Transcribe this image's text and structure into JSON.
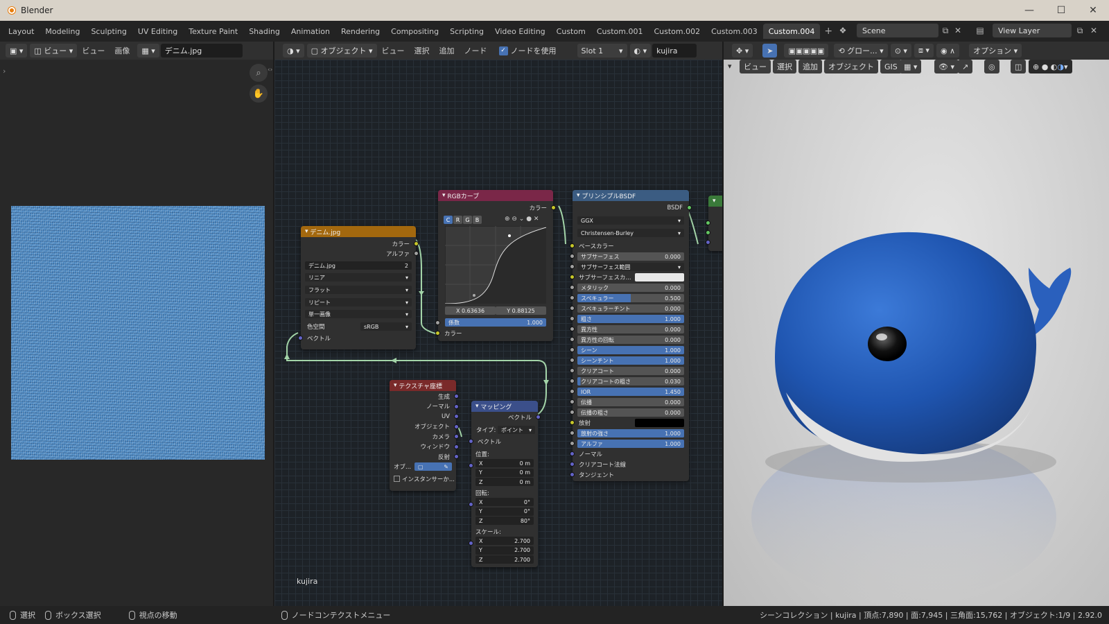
{
  "window": {
    "title": "Blender"
  },
  "workspaces": [
    "Layout",
    "Modeling",
    "Sculpting",
    "UV Editing",
    "Texture Paint",
    "Shading",
    "Animation",
    "Rendering",
    "Compositing",
    "Scripting",
    "Video Editing",
    "Custom",
    "Custom.001",
    "Custom.002",
    "Custom.003",
    "Custom.004"
  ],
  "active_workspace": "Custom.004",
  "scene": "Scene",
  "view_layer": "View Layer",
  "image_editor": {
    "view_menu": "ビュー",
    "image_menu": "画像",
    "view_mode": "ビュー",
    "image_name": "デニム.jpg"
  },
  "node_header": {
    "mode": "オブジェクト",
    "menus": [
      "ビュー",
      "選択",
      "追加",
      "ノード"
    ],
    "use_nodes": "ノードを使用",
    "slot": "Slot 1",
    "material": "kujira"
  },
  "viewport_header": {
    "transform": "グロー...",
    "options": "オプション",
    "menus": [
      "ビュー",
      "選択",
      "追加",
      "オブジェクト",
      "GIS"
    ]
  },
  "object_label": "kujira",
  "nodes": {
    "image": {
      "title": "デニム.jpg",
      "outputs": [
        "カラー",
        "アルファ"
      ],
      "image": "デニム.jpg",
      "users": "2",
      "interp": "リニア",
      "proj": "フラット",
      "ext": "リピート",
      "source": "単一画像",
      "cs_label": "色空間",
      "cs": "sRGB",
      "vector": "ベクトル"
    },
    "rgb": {
      "title": "RGBカーブ",
      "output": "カラー",
      "channels": [
        "C",
        "R",
        "G",
        "B"
      ],
      "x": "X 0.63636",
      "y": "Y 0.88125",
      "fac_label": "係数",
      "fac": "1.000",
      "input": "カラー"
    },
    "bsdf": {
      "title": "プリンシプルBSDF",
      "output": "BSDF",
      "dist": "GGX",
      "ss_method": "Christensen-Burley",
      "rows": [
        {
          "l": "ベースカラー"
        },
        {
          "l": "サブサーフェス",
          "v": "0.000"
        },
        {
          "l": "サブサーフェス範囲",
          "drop": true
        },
        {
          "l": "サブサーフェスカ...",
          "color": "#e8e8e8"
        },
        {
          "l": "メタリック",
          "v": "0.000"
        },
        {
          "l": "スペキュラー",
          "v": "0.500",
          "fill": 0.5
        },
        {
          "l": "スペキュラーチント",
          "v": "0.000"
        },
        {
          "l": "粗さ",
          "v": "1.000",
          "fill": 1
        },
        {
          "l": "異方性",
          "v": "0.000"
        },
        {
          "l": "異方性の回転",
          "v": "0.000"
        },
        {
          "l": "シーン",
          "v": "1.000",
          "fill": 1
        },
        {
          "l": "シーンチント",
          "v": "1.000",
          "fill": 1
        },
        {
          "l": "クリアコート",
          "v": "0.000"
        },
        {
          "l": "クリアコートの粗さ",
          "v": "0.030",
          "fill": 0.03
        },
        {
          "l": "IOR",
          "v": "1.450",
          "fill": 1
        },
        {
          "l": "伝播",
          "v": "0.000"
        },
        {
          "l": "伝播の粗さ",
          "v": "0.000"
        },
        {
          "l": "放射",
          "color": "#000000"
        },
        {
          "l": "放射の強さ",
          "v": "1.000",
          "fill": 1
        },
        {
          "l": "アルファ",
          "v": "1.000",
          "fill": 1
        },
        {
          "l": "ノーマル"
        },
        {
          "l": "クリアコート法線"
        },
        {
          "l": "タンジェント"
        }
      ]
    },
    "texcoord": {
      "title": "テクスチャ座標",
      "outputs": [
        "生成",
        "ノーマル",
        "UV",
        "オブジェクト",
        "カメラ",
        "ウィンドウ",
        "反射"
      ],
      "obj_label": "オブ...",
      "instancer": "インスタンサーか..."
    },
    "mapping": {
      "title": "マッピング",
      "output": "ベクトル",
      "type_label": "タイプ:",
      "type": "ポイント",
      "vector": "ベクトル",
      "loc_label": "位置:",
      "loc": [
        "0 m",
        "0 m",
        "0 m"
      ],
      "rot_label": "回転:",
      "rot": [
        "0°",
        "0°",
        "80°"
      ],
      "scale_label": "スケール:",
      "scale": [
        "2.700",
        "2.700",
        "2.700"
      ],
      "axes": [
        "X",
        "Y",
        "Z"
      ]
    }
  },
  "statusbar": {
    "select": "選択",
    "box": "ボックス選択",
    "pan": "視点の移動",
    "ctx": "ノードコンテクストメニュー",
    "stats": "シーンコレクション | kujira | 頂点:7,890 | 面:7,945 | 三角面:15,762 | オブジェクト:1/9 | 2.92.0"
  }
}
